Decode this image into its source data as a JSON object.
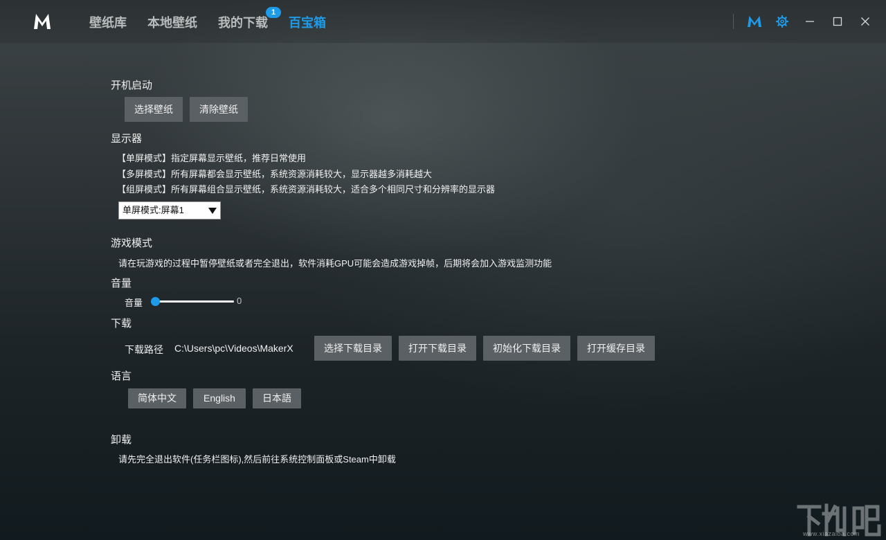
{
  "titlebar": {
    "nav": [
      {
        "label": "壁纸库"
      },
      {
        "label": "本地壁纸"
      },
      {
        "label": "我的下载",
        "badge": "1"
      },
      {
        "label": "百宝箱"
      }
    ]
  },
  "settings": {
    "startup": {
      "title": "开机启动",
      "select_wallpaper": "选择壁纸",
      "clear_wallpaper": "清除壁纸"
    },
    "display": {
      "title": "显示器",
      "lines": [
        "【单屏模式】指定屏幕显示壁纸，推荐日常使用",
        "【多屏模式】所有屏幕都会显示壁纸，系统资源消耗较大，显示器越多消耗越大",
        "【组屏模式】所有屏幕组合显示壁纸，系统资源消耗较大，适合多个相同尺寸和分辨率的显示器"
      ],
      "mode_selected": "单屏模式:屏幕1"
    },
    "game": {
      "title": "游戏模式",
      "desc": "请在玩游戏的过程中暂停壁纸或者完全退出，软件消耗GPU可能会造成游戏掉帧，后期将会加入游戏监测功能"
    },
    "volume": {
      "title": "音量",
      "label": "音量",
      "value": 0
    },
    "download": {
      "title": "下载",
      "path_label": "下载路径",
      "path_value": "C:\\Users\\pc\\Videos\\MakerX",
      "choose_dir": "选择下载目录",
      "open_dir": "打开下载目录",
      "init_dir": "初始化下载目录",
      "open_cache": "打开缓存目录"
    },
    "language": {
      "title": "语言",
      "options": [
        "简体中文",
        "English",
        "日本語"
      ]
    },
    "uninstall": {
      "title": "卸载",
      "desc": "请先完全退出软件(任务栏图标),然后前往系统控制面板或Steam中卸载"
    }
  },
  "watermark": {
    "text": "www.xiazaiba.com"
  },
  "colors": {
    "accent": "#1e9be8"
  },
  "icons": [
    "app-logo-icon",
    "m-brand-icon",
    "gear-icon",
    "minimize-icon",
    "maximize-icon",
    "close-icon"
  ]
}
